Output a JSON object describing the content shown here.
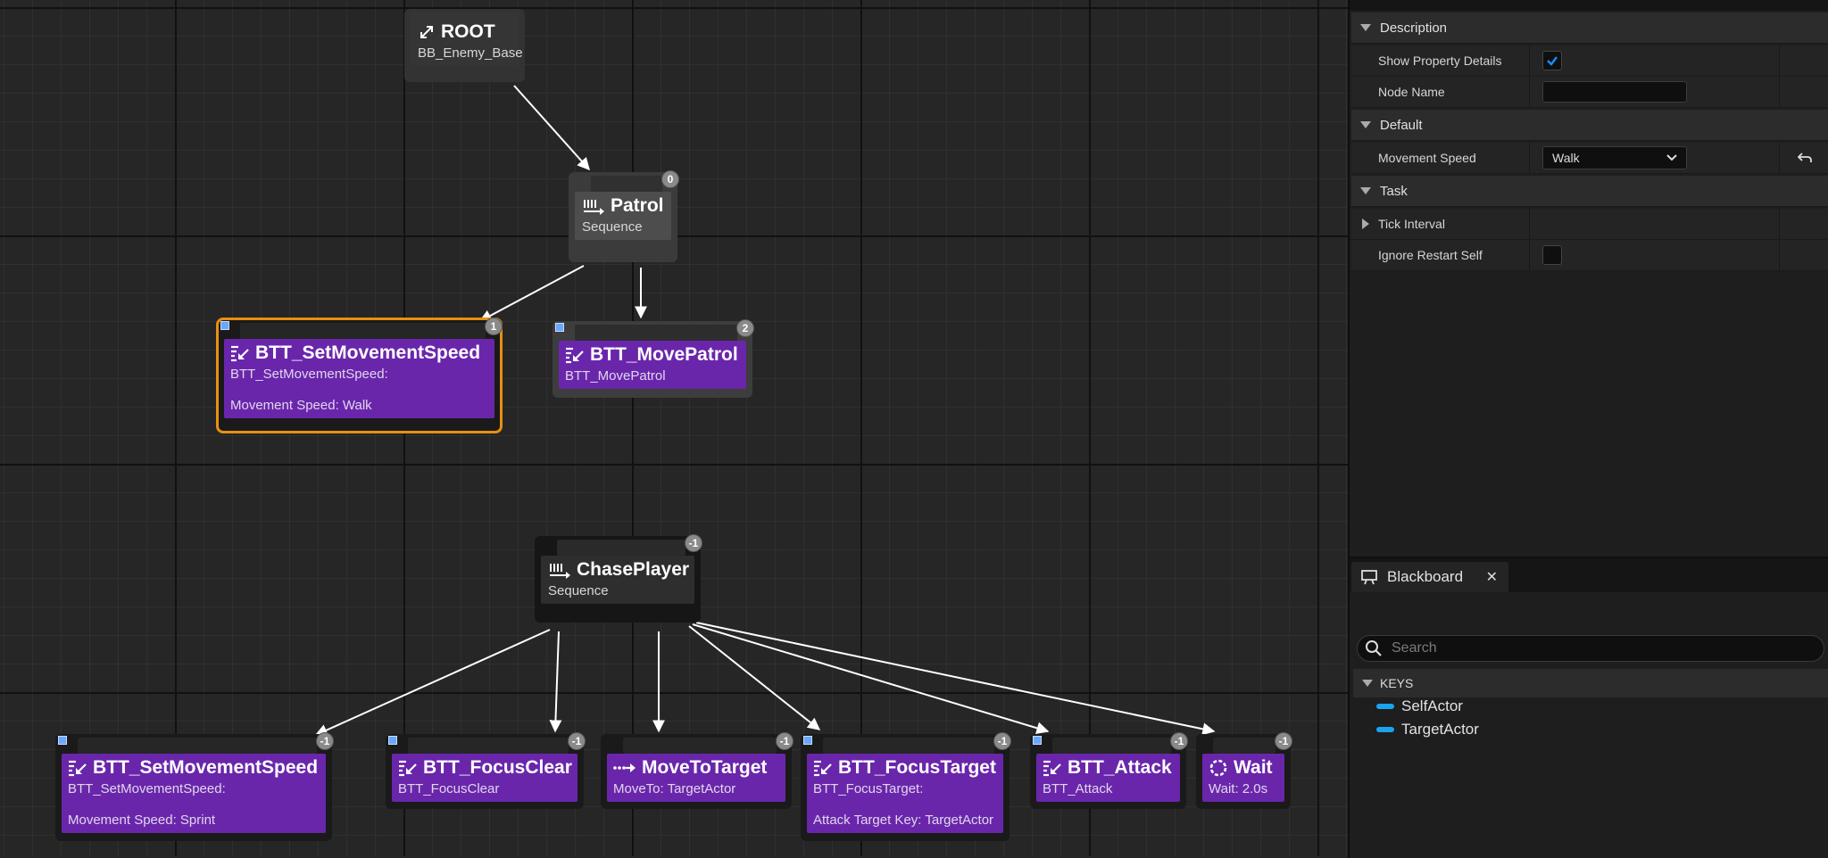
{
  "graph": {
    "root": {
      "title": "ROOT",
      "sub": "BB_Enemy_Base",
      "icon": "root-icon"
    },
    "patrol": {
      "title": "Patrol",
      "sub": "Sequence",
      "badge": "0",
      "icon": "sequence-icon"
    },
    "set_speed_walk": {
      "title": "BTT_SetMovementSpeed",
      "sub": "BTT_SetMovementSpeed:",
      "sub2": "Movement Speed: Walk",
      "badge": "1",
      "icon": "task-icon"
    },
    "move_patrol": {
      "title": "BTT_MovePatrol",
      "sub": "BTT_MovePatrol",
      "badge": "2",
      "icon": "task-icon"
    },
    "chase": {
      "title": "ChasePlayer",
      "sub": "Sequence",
      "badge": "-1",
      "icon": "sequence-icon"
    },
    "set_speed_sprint": {
      "title": "BTT_SetMovementSpeed",
      "sub": "BTT_SetMovementSpeed:",
      "sub2": "Movement Speed: Sprint",
      "badge": "-1",
      "icon": "task-icon"
    },
    "focus_clear": {
      "title": "BTT_FocusClear",
      "sub": "BTT_FocusClear",
      "badge": "-1",
      "icon": "task-icon"
    },
    "move_to": {
      "title": "MoveToTarget",
      "sub": "MoveTo: TargetActor",
      "badge": "-1",
      "icon": "move-to-icon"
    },
    "focus_target": {
      "title": "BTT_FocusTarget",
      "sub": "BTT_FocusTarget:",
      "sub2": "Attack Target Key: TargetActor",
      "badge": "-1",
      "icon": "task-icon"
    },
    "attack": {
      "title": "BTT_Attack",
      "sub": "BTT_Attack",
      "badge": "-1",
      "icon": "task-icon"
    },
    "wait": {
      "title": "Wait",
      "sub": "Wait: 2.0s",
      "badge": "-1",
      "icon": "wait-icon"
    }
  },
  "details": {
    "sections": {
      "description": "Description",
      "default": "Default",
      "task": "Task"
    },
    "props": {
      "show_property_details": {
        "label": "Show Property Details",
        "checked": true
      },
      "node_name": {
        "label": "Node Name",
        "value": ""
      },
      "movement_speed": {
        "label": "Movement Speed",
        "value": "Walk"
      },
      "tick_interval": {
        "label": "Tick Interval"
      },
      "ignore_restart_self": {
        "label": "Ignore Restart Self",
        "checked": false
      }
    }
  },
  "blackboard": {
    "tab_label": "Blackboard",
    "search_placeholder": "Search",
    "keys_header": "KEYS",
    "keys": [
      "SelfActor",
      "TargetActor"
    ],
    "key_color": "#1aa3ee"
  },
  "colors": {
    "task_purple": "#6a26ab",
    "selection": "#e7900f",
    "canvas": "#262626"
  }
}
